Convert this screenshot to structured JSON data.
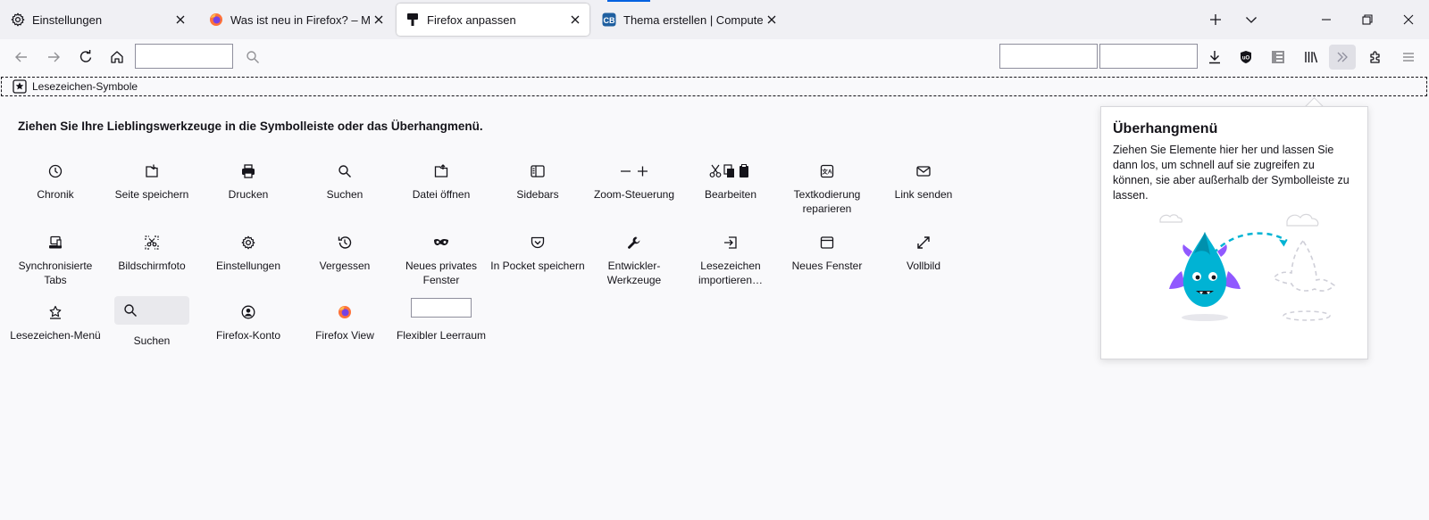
{
  "tabs": [
    {
      "label": "Einstellungen",
      "icon": "gear-icon"
    },
    {
      "label": "Was ist neu in Firefox? – Mehr P",
      "icon": "firefox-icon"
    },
    {
      "label": "Firefox anpassen",
      "icon": "customize-brush-icon"
    },
    {
      "label": "Thema erstellen | ComputerBase",
      "icon": "computerbase-icon"
    }
  ],
  "bookmarks_toolbar": {
    "label": "Lesezeichen-Symbole"
  },
  "palette": {
    "heading": "Ziehen Sie Ihre Lieblingswerkzeuge in die Symbolleiste oder das Überhangmenü.",
    "items": [
      {
        "label": "Chronik",
        "icon": "history-icon"
      },
      {
        "label": "Seite speichern",
        "icon": "save-page-icon"
      },
      {
        "label": "Drucken",
        "icon": "print-icon"
      },
      {
        "label": "Suchen",
        "icon": "search-icon"
      },
      {
        "label": "Datei öffnen",
        "icon": "open-file-icon"
      },
      {
        "label": "Sidebars",
        "icon": "sidebar-icon"
      },
      {
        "label": "Zoom-Steuerung",
        "icon": "zoom-controls-icon"
      },
      {
        "label": "Bearbeiten",
        "icon": "edit-controls-icon"
      },
      {
        "label": "Textkodierung reparieren",
        "icon": "text-encoding-icon"
      },
      {
        "label": "Link senden",
        "icon": "email-link-icon"
      },
      {
        "label": "Synchronisierte Tabs",
        "icon": "synced-tabs-icon"
      },
      {
        "label": "Bildschirmfoto",
        "icon": "screenshot-icon"
      },
      {
        "label": "Einstellungen",
        "icon": "gear-icon"
      },
      {
        "label": "Vergessen",
        "icon": "forget-icon"
      },
      {
        "label": "Neues privates Fenster",
        "icon": "private-window-icon"
      },
      {
        "label": "In Pocket speichern",
        "icon": "pocket-icon"
      },
      {
        "label": "Entwickler-Werkzeuge",
        "icon": "wrench-icon"
      },
      {
        "label": "Lesezeichen importieren…",
        "icon": "import-icon"
      },
      {
        "label": "Neues Fenster",
        "icon": "new-window-icon"
      },
      {
        "label": "Vollbild",
        "icon": "fullscreen-icon"
      },
      {
        "label": "Lesezeichen-Menü",
        "icon": "bookmarks-menu-icon"
      },
      {
        "label": "Suchen",
        "icon": "search-icon"
      },
      {
        "label": "Firefox-Konto",
        "icon": "account-icon"
      },
      {
        "label": "Firefox View",
        "icon": "firefox-view-icon"
      },
      {
        "label": "Flexibler Leerraum",
        "icon": "flexible-space"
      }
    ]
  },
  "overflow_panel": {
    "title": "Überhangmenü",
    "description": "Ziehen Sie Elemente hier her und lassen Sie dann los, um schnell auf sie zugreifen zu können, sie aber außerhalb der Symbolleiste zu lassen."
  },
  "colors": {
    "background": "#f9f9fb",
    "tabstrip": "#f0f0f4",
    "accent": "#0061e0",
    "firefox_orange": "#ff7139"
  }
}
